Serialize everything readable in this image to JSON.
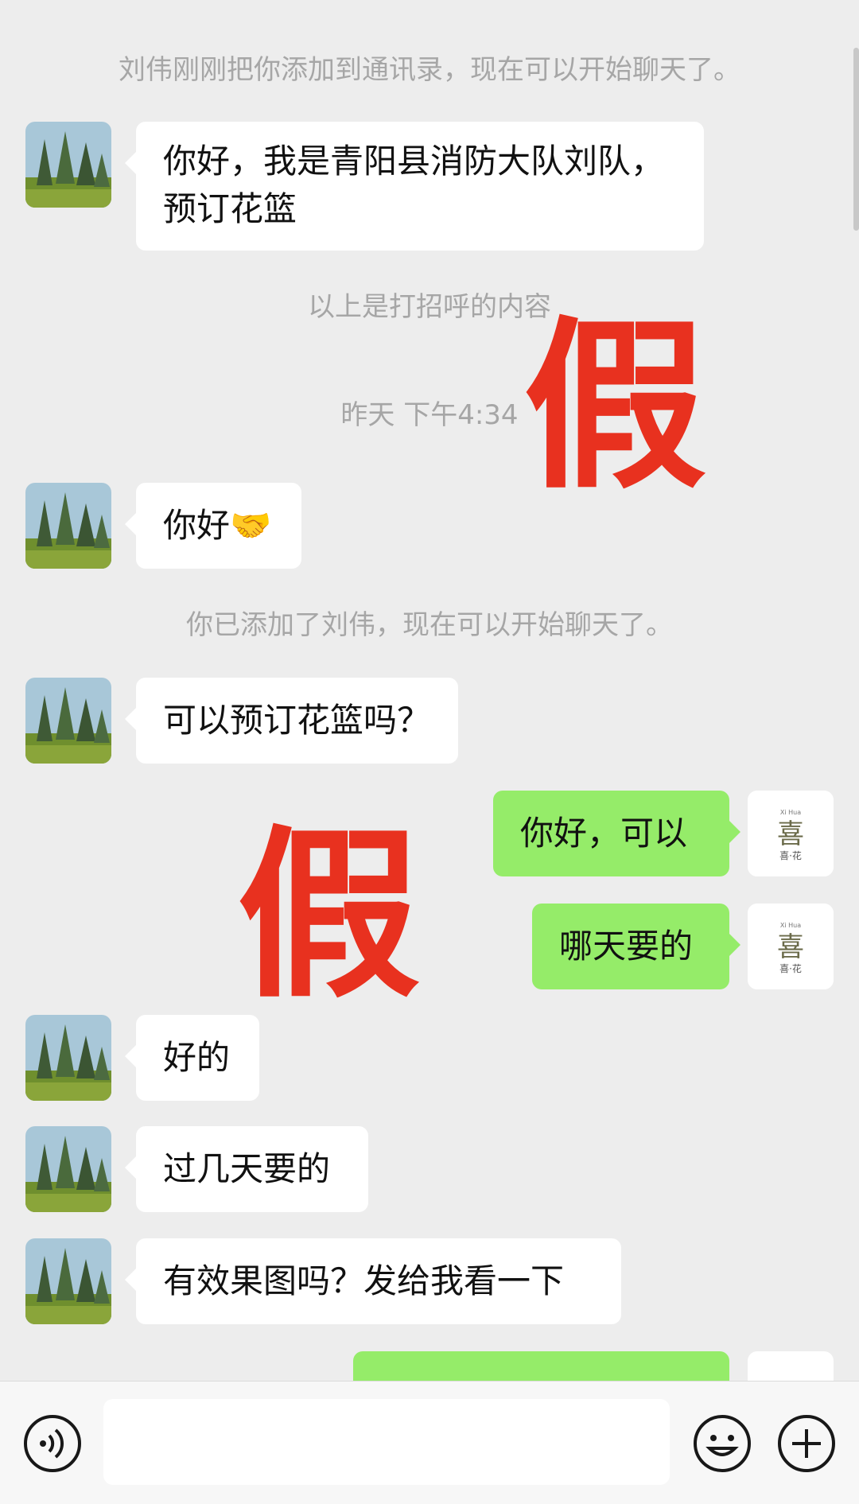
{
  "chat": {
    "system": {
      "added_by_contact": "刘伟刚刚把你添加到通讯录，现在可以开始聊天了。",
      "greeting_note": "以上是打招呼的内容",
      "timestamp": "昨天 下午4:34",
      "you_added": "你已添加了刘伟，现在可以开始聊天了。"
    },
    "messages": [
      {
        "side": "left",
        "text_line1": "你好，我是青阳县消防大队刘队，",
        "text_line2": "预订花篮"
      },
      {
        "side": "left",
        "text": "你好",
        "emoji": "🤝"
      },
      {
        "side": "left",
        "text": "可以预订花篮吗？"
      },
      {
        "side": "right",
        "text": "你好，可以"
      },
      {
        "side": "right",
        "text": "哪天要的"
      },
      {
        "side": "left",
        "text": "好的"
      },
      {
        "side": "left",
        "text": "过几天要的"
      },
      {
        "side": "left",
        "text": "有效果图吗？发给我看一下"
      }
    ],
    "own_avatar": {
      "top": "Xi Hua",
      "char": "喜",
      "bottom": "喜·花"
    }
  },
  "overlay": {
    "stamp": "假",
    "color": "#e8311f"
  },
  "input_bar": {
    "voice_icon": "voice-icon",
    "emoji_icon": "emoji-icon",
    "plus_icon": "plus-icon",
    "placeholder": ""
  },
  "colors": {
    "background": "#ededed",
    "incoming": "#ffffff",
    "outgoing": "#95ec69"
  }
}
